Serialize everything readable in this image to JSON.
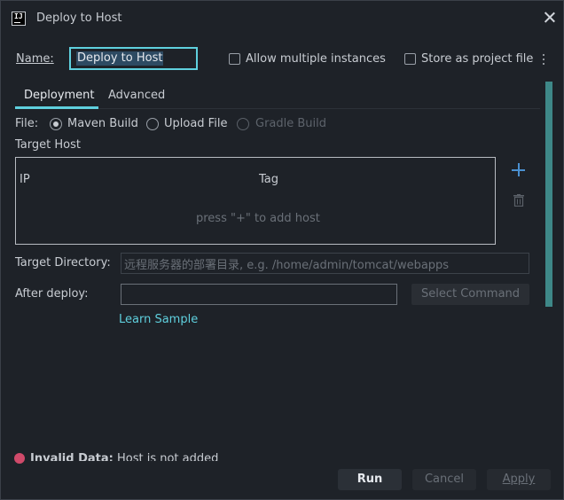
{
  "window": {
    "title": "Deploy to Host",
    "app_icon_text": "IJ"
  },
  "form": {
    "name_label": "Name:",
    "name_value": "Deploy to Host",
    "allow_multiple_label": "Allow multiple instances",
    "store_project_label": "Store as project file"
  },
  "tabs": [
    {
      "label": "Deployment",
      "active": true
    },
    {
      "label": "Advanced",
      "active": false
    }
  ],
  "file": {
    "label": "File:",
    "options": [
      {
        "label": "Maven Build",
        "selected": true,
        "enabled": true
      },
      {
        "label": "Upload File",
        "selected": false,
        "enabled": true
      },
      {
        "label": "Gradle Build",
        "selected": false,
        "enabled": false
      }
    ]
  },
  "target_host": {
    "label": "Target Host",
    "columns": [
      "IP",
      "Tag"
    ],
    "empty_text": "press \"+\" to add host"
  },
  "target_directory": {
    "label": "Target Directory:",
    "placeholder": "远程服务器的部署目录, e.g. /home/admin/tomcat/webapps"
  },
  "after_deploy": {
    "label": "After deploy:",
    "value": "",
    "select_command_label": "Select Command"
  },
  "learn_sample": "Learn Sample",
  "status": {
    "prefix": "Invalid Data:",
    "message": "Host is not added"
  },
  "footer": {
    "run": "Run",
    "cancel": "Cancel",
    "apply": "Apply"
  },
  "colors": {
    "accent": "#5fd0de",
    "background": "#1e2228",
    "error": "#d04a6a",
    "add_icon": "#4a90d0"
  }
}
